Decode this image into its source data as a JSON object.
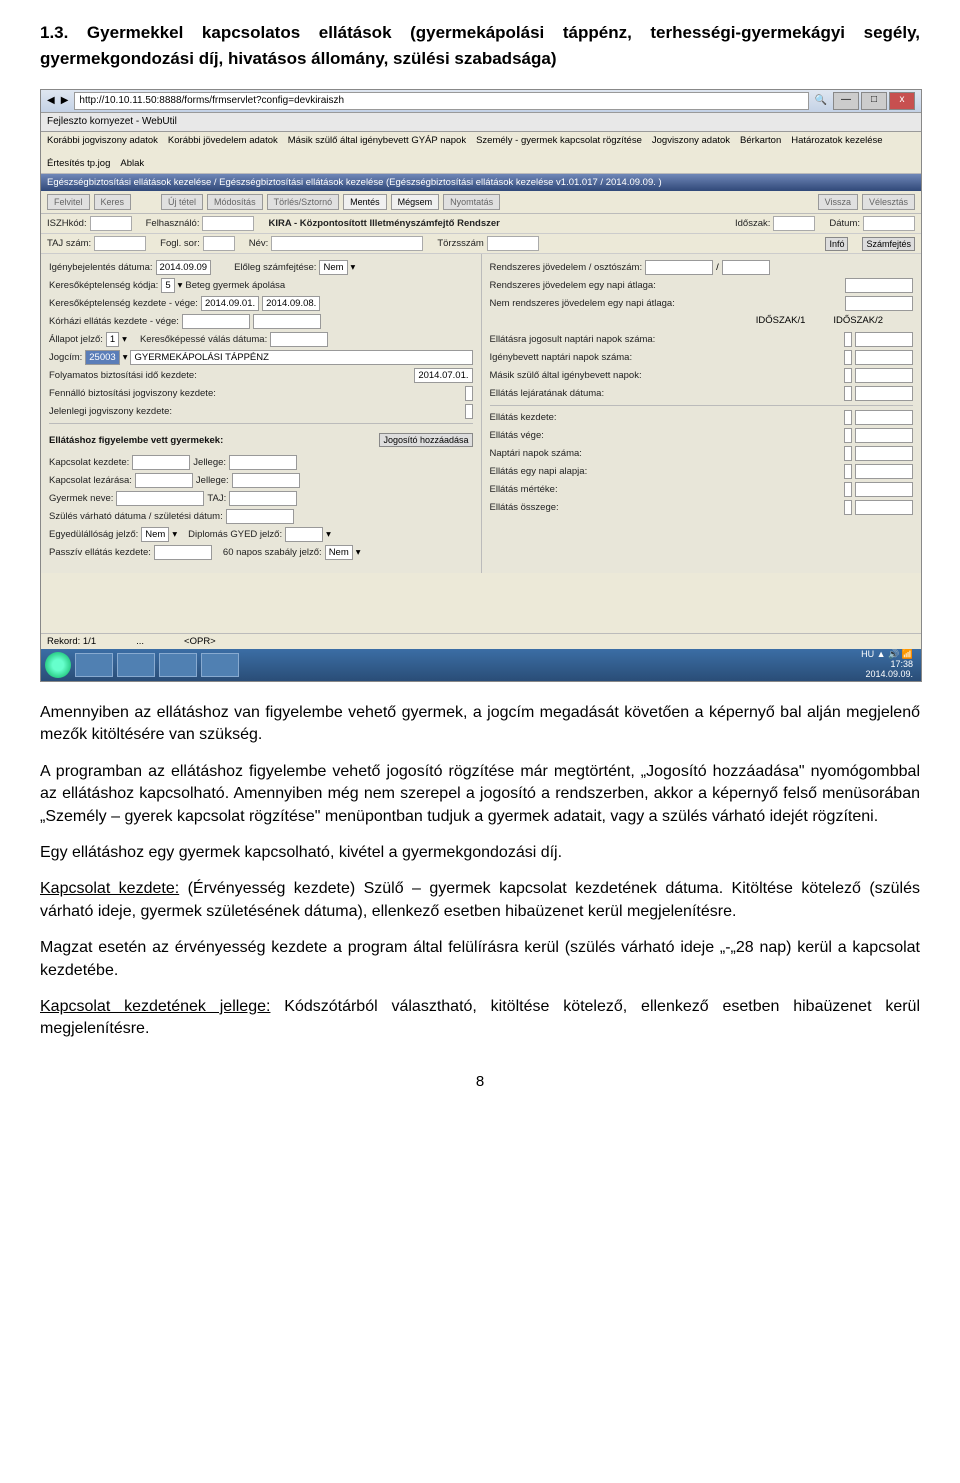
{
  "heading": "1.3. Gyermekkel kapcsolatos ellátások (gyermekápolási táppénz, terhességi-gyermekágyi segély, gyermekgondozási díj, hivatásos állomány, szülési szabadsága)",
  "browser": {
    "url": "http://10.10.11.50:8888/forms/frmservlet?config=devkiraiszh",
    "tab_title": "Fejleszto kornyezet - WebUtil",
    "win": {
      "min": "—",
      "max": "□",
      "close": "x"
    }
  },
  "menubar": [
    "Korábbi jogviszony adatok",
    "Korábbi jövedelem adatok",
    "Másik szülő által igénybevett GYÁP napok",
    "Személy - gyermek kapcsolat rögzítése",
    "Jogviszony adatok",
    "Bérkarton",
    "Határozatok kezelése",
    "Értesítés tp.jog",
    "Ablak"
  ],
  "winTitle": "Egészségbiztosítási ellátások kezelése / Egészségbiztosítási ellátások kezelése (Egészségbiztosítási ellátások kezelése v1.01.017 / 2014.09.09. )",
  "toolbar": {
    "g1": [
      "Felvitel",
      "Keres"
    ],
    "g2": [
      "Új tétel",
      "Módosítás",
      "Törlés/Sztornó",
      "Mentés",
      "Mégsem",
      "Nyomtatás"
    ],
    "g3": [
      "Vissza",
      "Vélesztás"
    ]
  },
  "info1": {
    "iszhkod": "ISZHkód:",
    "felh": "Felhasználó:",
    "kira": "KIRA - Központosított Illetményszámfejtő Rendszer",
    "idoszak": "Időszak:",
    "datum": "Dátum:"
  },
  "info2": {
    "taj": "TAJ szám:",
    "fogl": "Fogl. sor:",
    "nev": "Név:",
    "torzs": "Törzsszám",
    "info": "Infó",
    "szamf": "Számfejtés"
  },
  "left": {
    "l1a": "Igénybejelentés dátuma:",
    "l1a_v": "2014.09.09",
    "l1b": "Előleg számfejtése:",
    "l1b_v": "Nem",
    "l2a": "Keresőképtelenség kódja:",
    "l2a_v": "5",
    "l2b": "Beteg gyermek ápolása",
    "l3a": "Keresőképtelenség kezdete - vége:",
    "l3a_v1": "2014.09.01.",
    "l3a_v2": "2014.09.08.",
    "l4": "Kórházi ellátás kezdete - vége:",
    "l5a": "Állapot jelző:",
    "l5a_v": "1",
    "l5b": "Keresőképessé válás dátuma:",
    "l6a": "Jogcím:",
    "l6a_v": "25003",
    "l6b": "GYERMEKÁPOLÁSI TÁPPÉNZ",
    "l7": "Folyamatos biztosítási idő kezdete:",
    "l7_v": "2014.07.01.",
    "l8": "Fennálló biztosítási jogviszony kezdete:",
    "l9": "Jelenlegi jogviszony kezdete:",
    "ghdr": "Ellátáshoz figyelembe vett gyermekek:",
    "gbtn": "Jogosító hozzáadása",
    "g1a": "Kapcsolat kezdete:",
    "g1b": "Jellege:",
    "g2a": "Kapcsolat lezárása:",
    "g2b": "Jellege:",
    "g3a": "Gyermek neve:",
    "g3b": "TAJ:",
    "g4": "Szülés várható dátuma / születési dátum:",
    "g5a": "Egyedülállóság jelző:",
    "g5a_v": "Nem",
    "g5b": "Diplomás GYED jelző:",
    "g6a": "Passzív ellátás kezdete:",
    "g6b": "60 napos szabály jelző:",
    "g6b_v": "Nem"
  },
  "right": {
    "r1": "Rendszeres jövedelem / osztószám:",
    "r1sep": "/",
    "r2": "Rendszeres jövedelem egy napi átlaga:",
    "r3": "Nem rendszeres jövedelem egy napi átlaga:",
    "h1": "IDŐSZAK/1",
    "h2": "IDŐSZAK/2",
    "r4": "Ellátásra jogosult naptári napok száma:",
    "r5": "Igénybevett naptári napok száma:",
    "r6": "Másik szülő által igénybevett napok:",
    "r7": "Ellátás lejáratának dátuma:",
    "r8": "Ellátás kezdete:",
    "r9": "Ellátás vége:",
    "r10": "Naptári napok száma:",
    "r11": "Ellátás egy napi alapja:",
    "r12": "Ellátás mértéke:",
    "r13": "Ellátás összege:"
  },
  "status": {
    "rec": "Rekord: 1/1",
    "opr": "<OPR>"
  },
  "taskbar": {
    "lang": "HU",
    "time": "17:38",
    "date": "2014.09.09."
  },
  "para1": "Amennyiben az ellátáshoz van figyelembe vehető gyermek, a jogcím megadását követően a képernyő bal alján megjelenő mezők kitöltésére van szükség.",
  "para2": "A programban az ellátáshoz figyelembe vehető jogosító rögzítése már megtörtént, „Jogosító hozzáadása\" nyomógombbal az ellátáshoz kapcsolható. Amennyiben még nem szerepel a jogosító a rendszerben, akkor a képernyő felső menüsorában „Személy – gyerek kapcsolat rögzítése\" menüpontban tudjuk a gyermek adatait, vagy a szülés várható idejét rögzíteni.",
  "para3": "Egy ellátáshoz egy gyermek kapcsolható, kivétel a gyermekgondozási díj.",
  "para4_u": "Kapcsolat kezdete:",
  "para4": " (Érvényesség kezdete) Szülő – gyermek kapcsolat kezdetének dátuma. Kitöltése kötelező (szülés várható ideje, gyermek születésének dátuma), ellenkező esetben hibaüzenet kerül megjelenítésre.",
  "para5": "Magzat esetén az érvényesség kezdete a program által felülírásra kerül (szülés várható ideje „-„28 nap) kerül a kapcsolat kezdetébe.",
  "para6_u": "Kapcsolat kezdetének jellege:",
  "para6": " Kódszótárból választható, kitöltése kötelező, ellenkező esetben hibaüzenet kerül megjelenítésre.",
  "pageNum": "8"
}
